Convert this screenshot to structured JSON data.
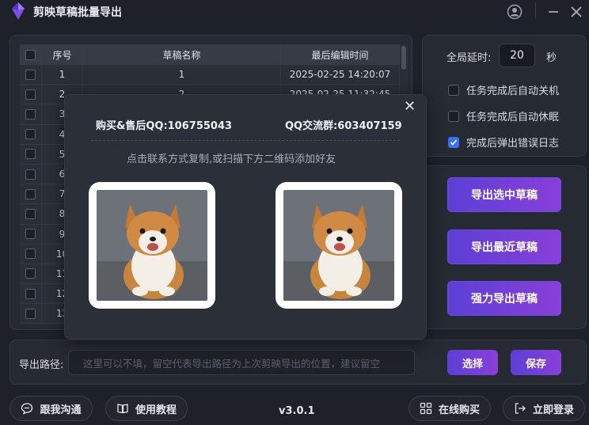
{
  "app": {
    "title": "剪映草稿批量导出"
  },
  "table": {
    "columns": [
      "序号",
      "草稿名称",
      "最后编辑时间"
    ],
    "rows": [
      {
        "index": "1",
        "name": "1",
        "time": "2025-02-25 14:20:07"
      },
      {
        "index": "2",
        "name": "2",
        "time": "2025-02-25 11:32:45"
      },
      {
        "index": "3",
        "name": "",
        "time": ""
      },
      {
        "index": "4",
        "name": "",
        "time": ""
      },
      {
        "index": "5",
        "name": "",
        "time": ""
      },
      {
        "index": "6",
        "name": "",
        "time": ""
      },
      {
        "index": "7",
        "name": "",
        "time": ""
      },
      {
        "index": "8",
        "name": "",
        "time": ""
      },
      {
        "index": "9",
        "name": "",
        "time": ""
      },
      {
        "index": "10",
        "name": "",
        "time": ""
      },
      {
        "index": "11",
        "name": "",
        "time": ""
      },
      {
        "index": "12",
        "name": "",
        "time": ""
      },
      {
        "index": "13",
        "name": "",
        "time": ""
      }
    ]
  },
  "settings": {
    "delay_label": "全局延时:",
    "delay_value": "20",
    "delay_unit": "秒",
    "options": [
      {
        "label": "任务完成后自动关机",
        "checked": false
      },
      {
        "label": "任务完成后自动休眠",
        "checked": false
      },
      {
        "label": "完成后弹出错误日志",
        "checked": true
      }
    ]
  },
  "actions": {
    "export_selected": "导出选中草稿",
    "export_recent": "导出最近草稿",
    "force_export": "强力导出草稿"
  },
  "export_path": {
    "label": "导出路径:",
    "placeholder": "这里可以不填，留空代表导出路径为上次剪映导出的位置，建议留空",
    "choose": "选择",
    "save": "保存"
  },
  "footer": {
    "chat": "跟我沟通",
    "tutorial": "使用教程",
    "version": "v3.0.1",
    "buy": "在线购买",
    "login": "立即登录"
  },
  "modal": {
    "contact_qq": "购买&售后QQ:106755043",
    "group_qq": "QQ交流群:603407159",
    "hint": "点击联系方式复制,或扫描下方二维码添加好友"
  },
  "colors": {
    "accent": "#6a3fd8",
    "background": "#1e2129",
    "checkbox_on": "#3d6ff5"
  }
}
